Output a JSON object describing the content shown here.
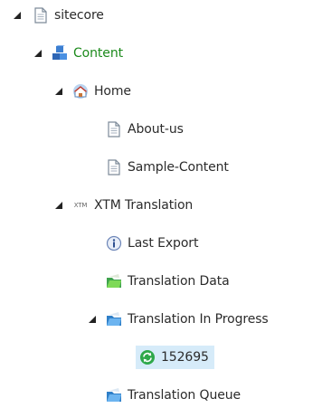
{
  "tree": {
    "root": {
      "label": "sitecore",
      "icon": "document-icon",
      "expanded": true
    },
    "content": {
      "label": "Content",
      "icon": "content-cubes-icon",
      "expanded": true,
      "label_color": "#1c8a1c"
    },
    "home": {
      "label": "Home",
      "icon": "home-icon",
      "expanded": true
    },
    "about_us": {
      "label": "About-us",
      "icon": "document-icon"
    },
    "sample_content": {
      "label": "Sample-Content",
      "icon": "document-icon"
    },
    "xtm_translation": {
      "label": "XTM Translation",
      "icon_text": "XTM",
      "expanded": true
    },
    "last_export": {
      "label": "Last Export",
      "icon": "info-icon"
    },
    "translation_data": {
      "label": "Translation Data",
      "icon": "green-folder-icon"
    },
    "translation_in_progress": {
      "label": "Translation In Progress",
      "icon": "blue-folder-icon",
      "expanded": true
    },
    "item_152695": {
      "label": "152695",
      "icon": "green-sync-icon",
      "selected": true,
      "selected_bg": "#d6ebf9"
    },
    "translation_queue": {
      "label": "Translation Queue",
      "icon": "blue-folder-icon"
    }
  }
}
